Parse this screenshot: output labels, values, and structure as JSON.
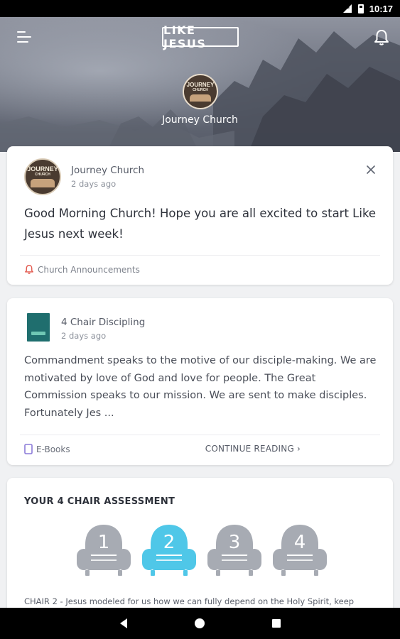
{
  "status_bar": {
    "time": "10:17"
  },
  "header": {
    "logo_text": "LIKE JESUS",
    "church_name": "Journey Church",
    "avatar_text_1": "JOURNEY",
    "avatar_text_2": "CHURCH"
  },
  "announcement": {
    "author": "Journey Church",
    "time": "2 days ago",
    "message": "Good Morning Church! Hope you are all excited to start Like Jesus next week!",
    "category": "Church Announcements",
    "avatar_text_1": "JOURNEY",
    "avatar_text_2": "CHURCH"
  },
  "ebook": {
    "title": "4 Chair Discipling",
    "time": "2 days ago",
    "excerpt": "Commandment speaks to the motive of our disciple-making. We are motivated by love of God and love for people. The Great Commission speaks to our mission. We are sent to make disciples. Fortunately Jes ...",
    "category": "E-Books",
    "continue_label": "CONTINUE READING"
  },
  "assessment": {
    "title": "YOUR 4 CHAIR ASSESSMENT",
    "chairs": [
      {
        "label": "1",
        "color": "#a7abb3"
      },
      {
        "label": "2",
        "color": "#4fc7e8"
      },
      {
        "label": "3",
        "color": "#a7abb3"
      },
      {
        "label": "4",
        "color": "#a7abb3"
      }
    ],
    "selected_chair": "2",
    "description": "CHAIR 2 - Jesus modeled for us how we can fully depend on the Holy Spirit, keep"
  },
  "colors": {
    "accent_blue": "#4fc7e8",
    "chair_gray": "#a7abb3",
    "announcement_red": "#e2574c",
    "ebook_purple": "#8c7bd9"
  }
}
